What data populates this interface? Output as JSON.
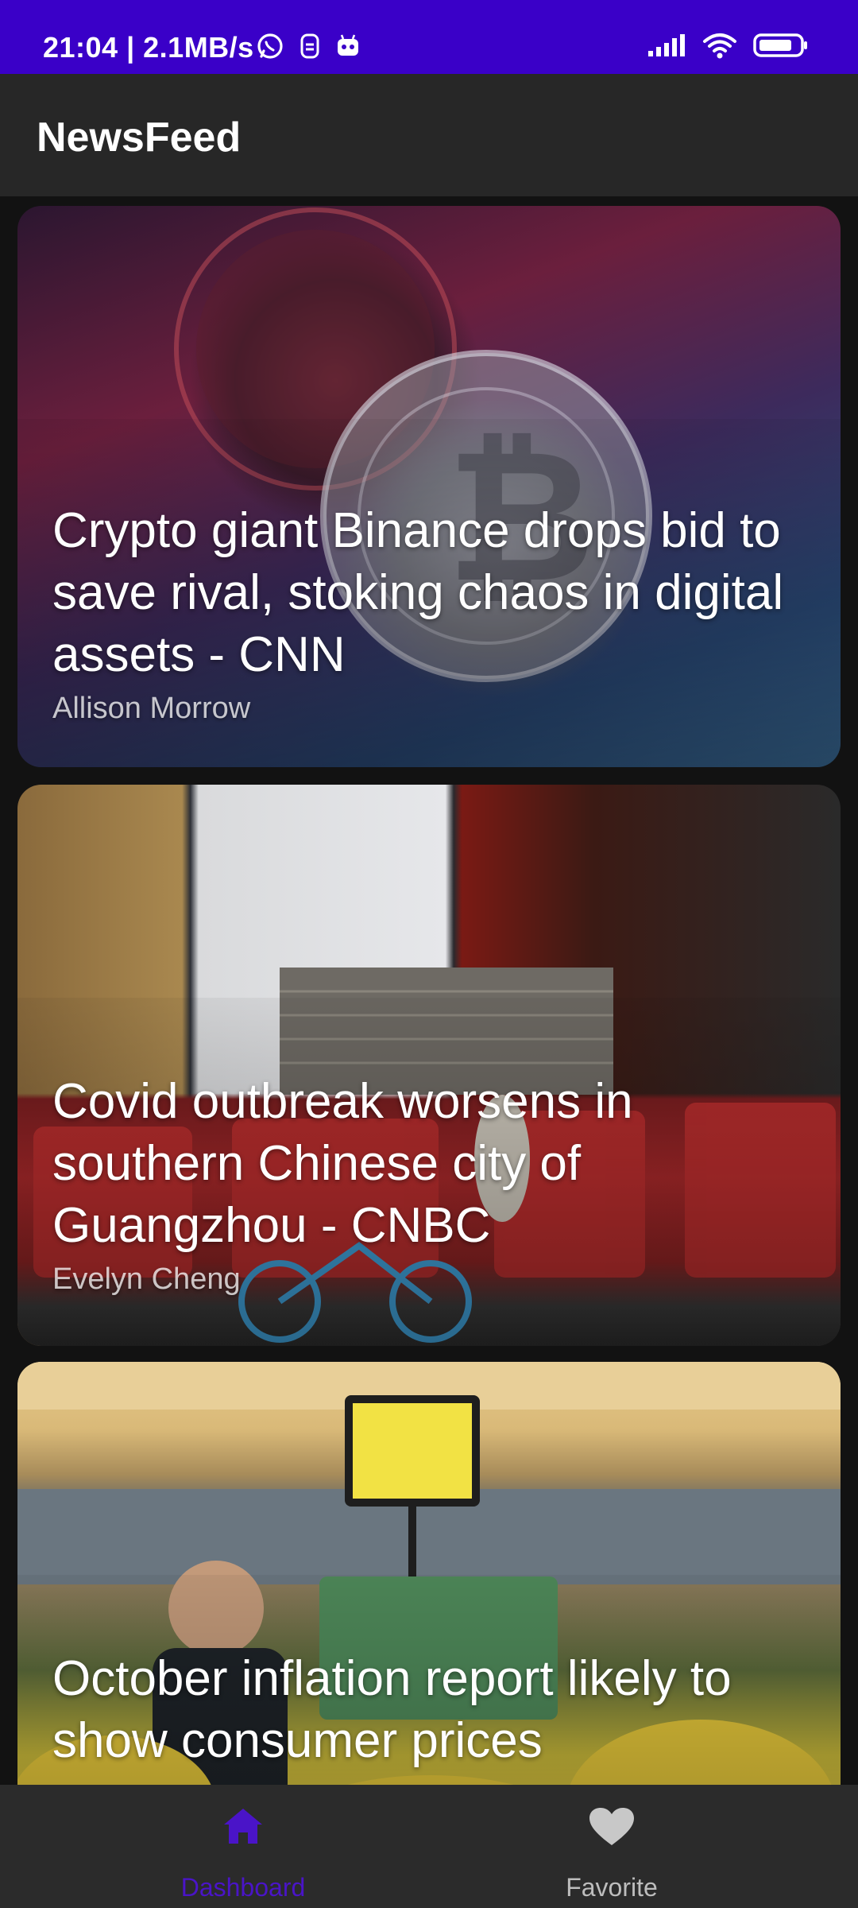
{
  "status_bar": {
    "time": "21:04 | 2.1MB/s",
    "app_icons": [
      "whatsapp-icon",
      "notification-icon",
      "app-icon"
    ],
    "system_icons": [
      "signal-icon",
      "wifi-icon",
      "battery-icon"
    ]
  },
  "app_bar": {
    "title": "NewsFeed"
  },
  "articles": [
    {
      "title": "Crypto giant Binance drops bid to save rival, stoking chaos in digital assets - CNN",
      "author": "Allison Morrow"
    },
    {
      "title": "Covid outbreak worsens in southern Chinese city of Guangzhou - CNBC",
      "author": "Evelyn Cheng"
    },
    {
      "title": "October inflation report likely to show consumer prices"
    }
  ],
  "bottom_nav": {
    "items": [
      {
        "label": "Dashboard",
        "icon": "home-icon",
        "active": true
      },
      {
        "label": "Favorite",
        "icon": "heart-icon",
        "active": false
      }
    ]
  },
  "colors": {
    "status_bar": "#3a00c8",
    "app_bar": "#272727",
    "background": "#121212",
    "accent": "#4a14c8",
    "inactive": "#bdbdbd"
  }
}
